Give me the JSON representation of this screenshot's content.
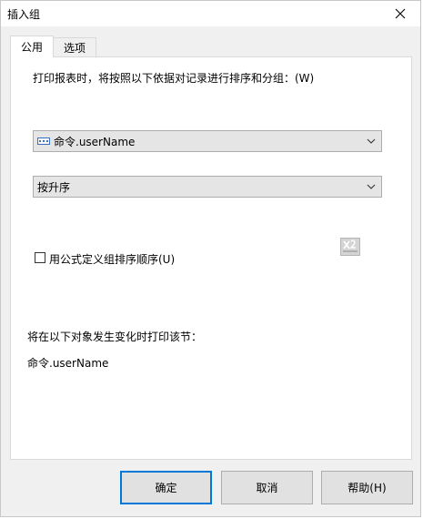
{
  "window": {
    "title": "插入组"
  },
  "tabs": [
    {
      "label": "公用"
    },
    {
      "label": "选项"
    }
  ],
  "common": {
    "instruction": "打印报表时，将按照以下依据对记录进行排序和分组：(W)",
    "group_field": {
      "value": "命令.userName",
      "icon": "database-field-icon"
    },
    "sort_order": {
      "value": "按升序"
    },
    "use_formula": {
      "label": "用公式定义组排序顺序(U)",
      "checked": false
    },
    "print_section_label": "将在以下对象发生变化时打印该节：",
    "print_section_value": "命令.userName"
  },
  "buttons": {
    "ok": "确定",
    "cancel": "取消",
    "help": "帮助(H)"
  },
  "colors": {
    "default_button_border": "#0078d7"
  }
}
